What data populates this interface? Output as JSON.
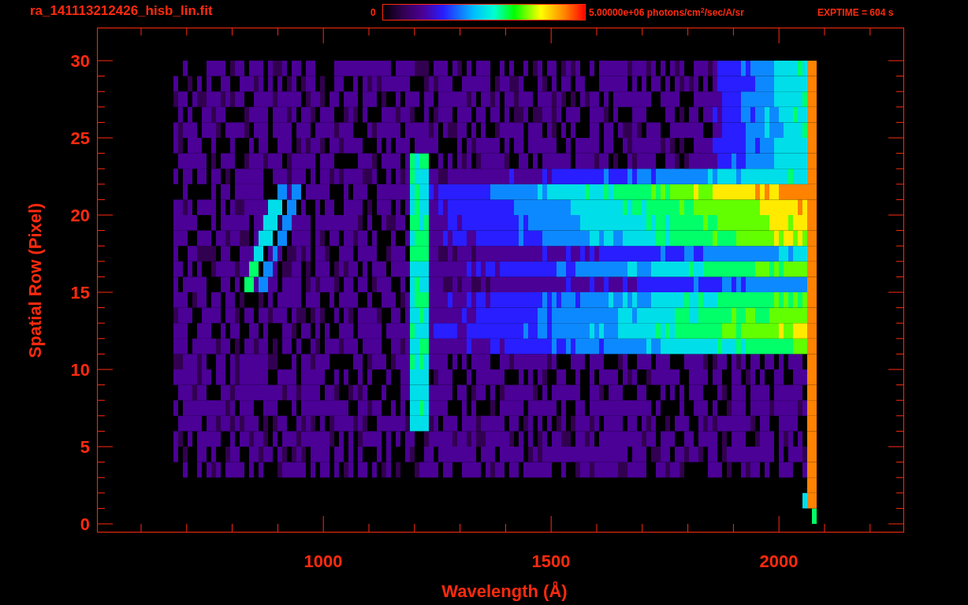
{
  "title": "ra_141113212426_hisb_lin.fit",
  "colorbar": {
    "min_label": "0",
    "max_label": "5.00000e+06 photons/cm$^{2}$/sec/A/sr"
  },
  "exposure": "EXPTIME = 604 s",
  "x_axis": {
    "label": "Wavelength (Å)",
    "ticks": [
      "1000",
      "1500",
      "2000"
    ]
  },
  "y_axis": {
    "label": "Spatial Row (Pixel)",
    "ticks": [
      "30",
      "25",
      "20",
      "15",
      "10",
      "5",
      "0"
    ]
  }
}
